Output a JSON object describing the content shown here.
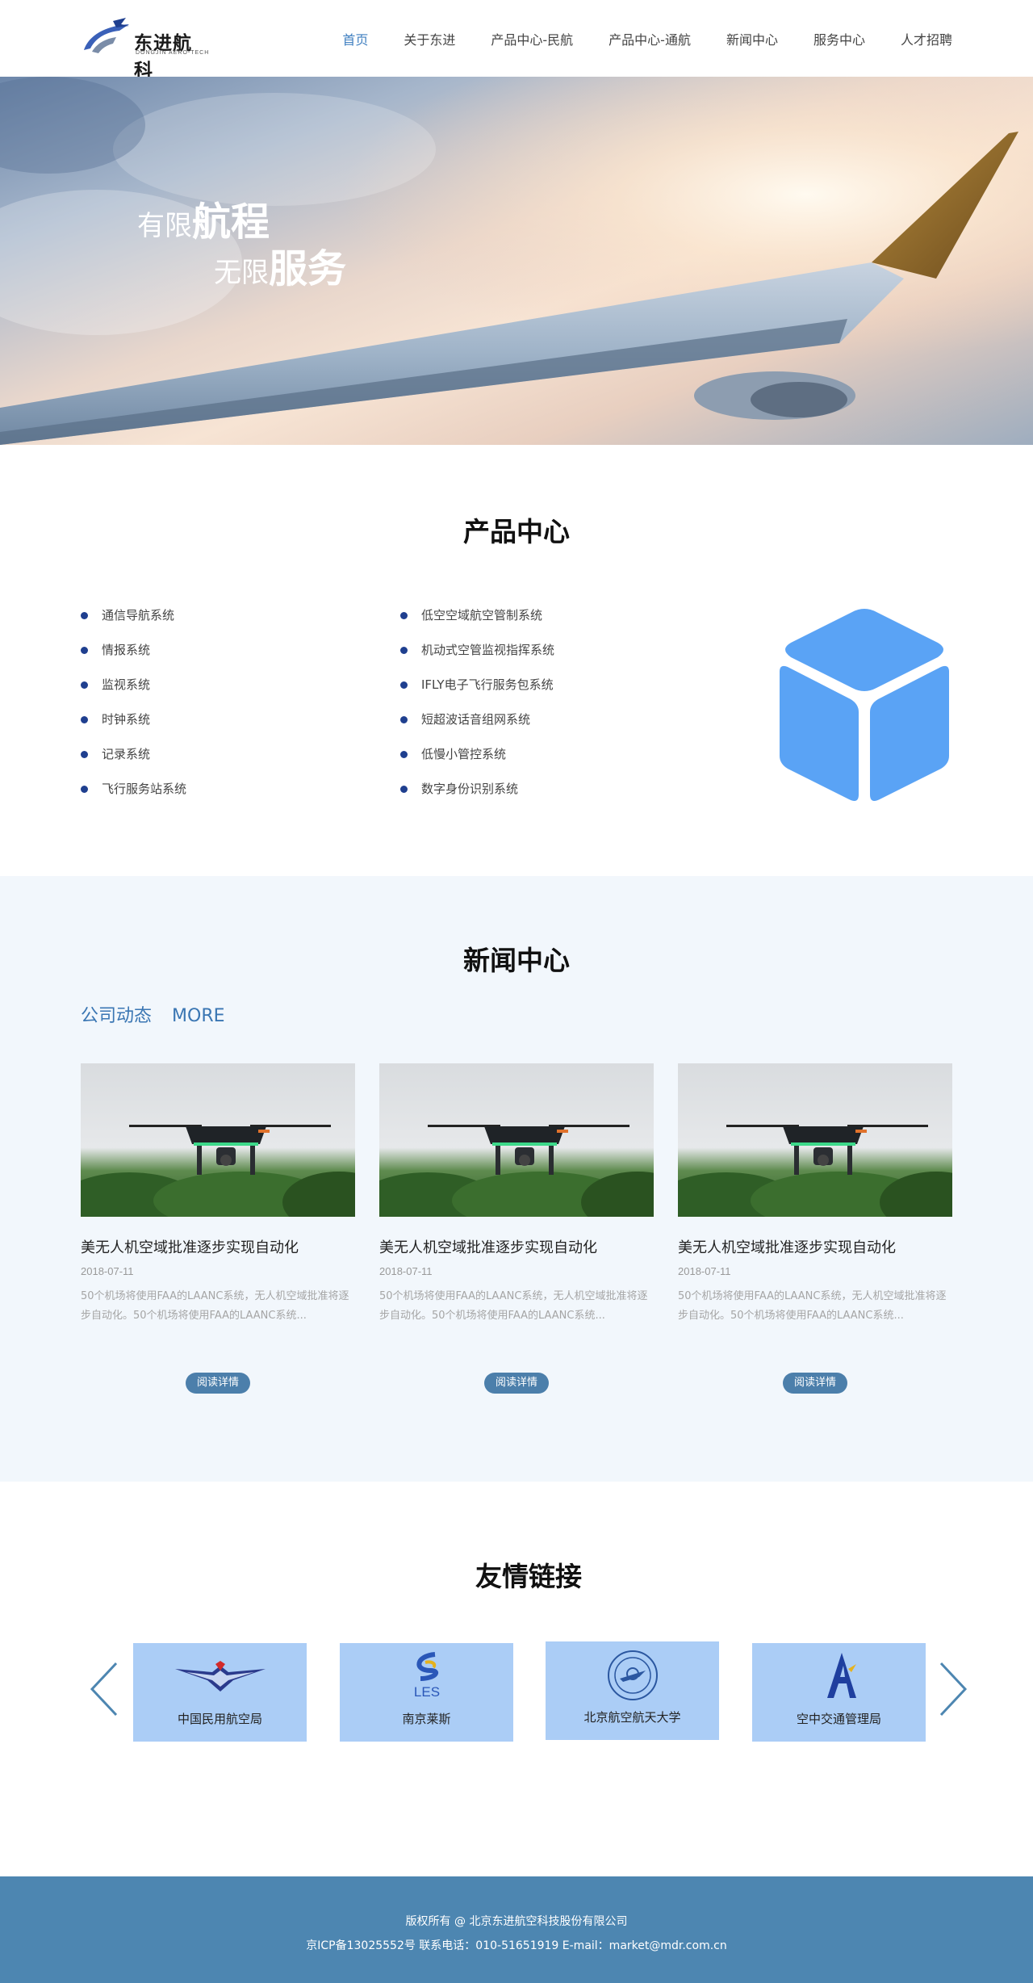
{
  "header": {
    "logo_cn": "东进航科",
    "logo_en": "DONGJIN AERO-TECH",
    "nav": [
      "首页",
      "关于东进",
      "产品中心-民航",
      "产品中心-通航",
      "新闻中心",
      "服务中心",
      "人才招聘"
    ],
    "active_index": 0
  },
  "banner": {
    "slogan1_light": "有限",
    "slogan1_bold": "航程",
    "slogan2_light": "无限",
    "slogan2_bold": "服务"
  },
  "products": {
    "title": "产品中心",
    "col1": [
      "通信导航系统",
      "情报系统",
      "监视系统",
      "时钟系统",
      "记录系统",
      "飞行服务站系统"
    ],
    "col2": [
      "低空空域航空管制系统",
      "机动式空管监视指挥系统",
      "IFLY电子飞行服务包系统",
      "短超波话音组网系统",
      "低慢小管控系统",
      "数字身份识别系统"
    ],
    "icon": "cube-icon",
    "icon_color": "#5aa3f5"
  },
  "news": {
    "title": "新闻中心",
    "tabs": [
      "公司动态",
      "MORE"
    ],
    "items": [
      {
        "title": "美无人机空域批准逐步实现自动化",
        "date": "2018-07-11",
        "desc": "50个机场将使用FAA的LAANC系统，无人机空域批准将逐步自动化。50个机场将使用FAA的LAANC系统...",
        "button": "阅读详情"
      },
      {
        "title": "美无人机空域批准逐步实现自动化",
        "date": "2018-07-11",
        "desc": "50个机场将使用FAA的LAANC系统，无人机空域批准将逐步自动化。50个机场将使用FAA的LAANC系统...",
        "button": "阅读详情"
      },
      {
        "title": "美无人机空域批准逐步实现自动化",
        "date": "2018-07-11",
        "desc": "50个机场将使用FAA的LAANC系统，无人机空域批准将逐步自动化。50个机场将使用FAA的LAANC系统...",
        "button": "阅读详情"
      }
    ]
  },
  "links": {
    "title": "友情链接",
    "items": [
      {
        "label": "中国民用航空局",
        "icon": "caac-logo-icon"
      },
      {
        "label": "南京莱斯",
        "icon": "les-logo-icon",
        "logo_text": "LES"
      },
      {
        "label": "北京航空航天大学",
        "icon": "buaa-seal-icon"
      },
      {
        "label": "空中交通管理局",
        "icon": "atmb-logo-icon"
      }
    ],
    "prev_icon": "chevron-left-icon",
    "next_icon": "chevron-right-icon"
  },
  "footer": {
    "line1": "版权所有 @ 北京东进航空科技股份有限公司",
    "line2": "京ICP备13025552号   联系电话：010-51651919    E-mail：market@mdr.com.cn"
  },
  "colors": {
    "accent": "#3f7fc0",
    "footer_bg": "#4d86b1",
    "news_bg": "#f2f7fc",
    "link_card_bg": "#abcdf6",
    "bullet": "#1f3f8f"
  }
}
